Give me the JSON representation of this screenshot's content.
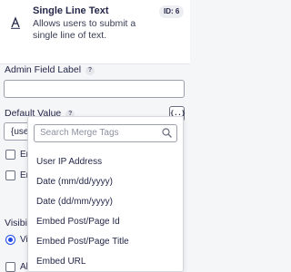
{
  "field_card": {
    "title": "Single Line Text",
    "description": "Allows users to submit a single line of text.",
    "id_badge": "ID: 6",
    "icon": "text-a-icon"
  },
  "settings": {
    "admin_field_label": "Admin Field Label",
    "help_mark": "?",
    "default_value_label": "Default Value",
    "default_value_prefix": "{user",
    "merge_tags_button": "{..}",
    "checkbox_1_prefix": "Er",
    "checkbox_2_prefix": "Er",
    "visibility_prefix": "Visibilit",
    "visibility_radio_prefix": "Vi",
    "bottom_checkbox_prefix": "Al"
  },
  "merge_tags": {
    "search_placeholder": "Search Merge Tags",
    "items": [
      "User IP Address",
      "Date (mm/dd/yyyy)",
      "Date (dd/mm/yyyy)",
      "Embed Post/Page Id",
      "Embed Post/Page Title",
      "Embed URL"
    ]
  },
  "colors": {
    "accent": "#204ce5",
    "text": "#242748",
    "background": "#f5f6f8"
  }
}
